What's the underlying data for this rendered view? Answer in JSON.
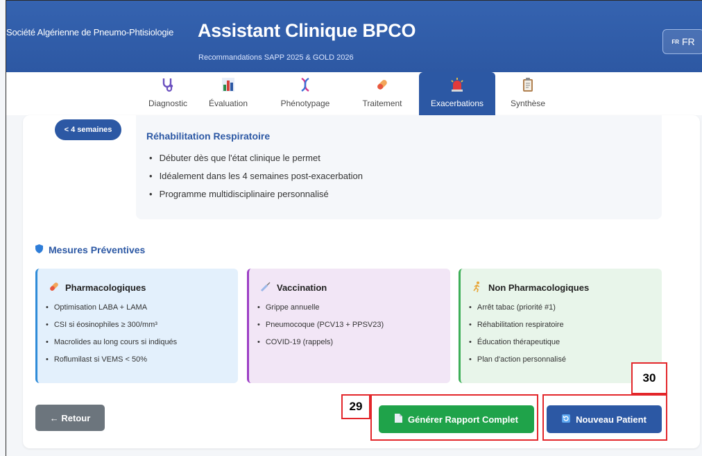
{
  "header": {
    "society": "Société Algérienne de Pneumo-Phtisiologie",
    "title": "Assistant Clinique BPCO",
    "subtitle": "Recommandations SAPP 2025 & GOLD 2026",
    "lang_flag": "FR",
    "lang_label": "FR"
  },
  "tabs": [
    {
      "label": "Diagnostic",
      "icon": "stethoscope-icon",
      "active": false
    },
    {
      "label": "Évaluation",
      "icon": "bar-chart-icon",
      "active": false
    },
    {
      "label": "Phénotypage",
      "icon": "dna-icon",
      "active": false
    },
    {
      "label": "Traitement",
      "icon": "pill-icon",
      "active": false
    },
    {
      "label": "Exacerbations",
      "icon": "siren-icon",
      "active": true
    },
    {
      "label": "Synthèse",
      "icon": "clipboard-icon",
      "active": false
    }
  ],
  "rehab": {
    "badge": "< 4 semaines",
    "title": "Réhabilitation Respiratoire",
    "items": [
      "Débuter dès que l'état clinique le permet",
      "Idéalement dans les 4 semaines post-exacerbation",
      "Programme multidisciplinaire personnalisé"
    ]
  },
  "preventive": {
    "title": "Mesures Préventives",
    "icon": "shield-icon",
    "columns": [
      {
        "title": "Pharmacologiques",
        "icon": "pill-icon",
        "items": [
          "Optimisation LABA + LAMA",
          "CSI si éosinophiles ≥ 300/mm³",
          "Macrolides au long cours si indiqués",
          "Roflumilast si VEMS < 50%"
        ]
      },
      {
        "title": "Vaccination",
        "icon": "syringe-icon",
        "items": [
          "Grippe annuelle",
          "Pneumocoque (PCV13 + PPSV23)",
          "COVID-19 (rappels)"
        ]
      },
      {
        "title": "Non Pharmacologiques",
        "icon": "runner-icon",
        "items": [
          "Arrêt tabac (priorité #1)",
          "Réhabilitation respiratoire",
          "Éducation thérapeutique",
          "Plan d'action personnalisé"
        ]
      }
    ]
  },
  "buttons": {
    "back": "← Retour",
    "report": "Générer Rapport Complet",
    "new_patient": "Nouveau Patient"
  },
  "annotations": {
    "report_number": "29",
    "new_patient_number": "30"
  },
  "colors": {
    "primary": "#2c58a4",
    "success": "#1fa34a",
    "secondary": "#6c757d",
    "annotation": "#e3262a"
  }
}
